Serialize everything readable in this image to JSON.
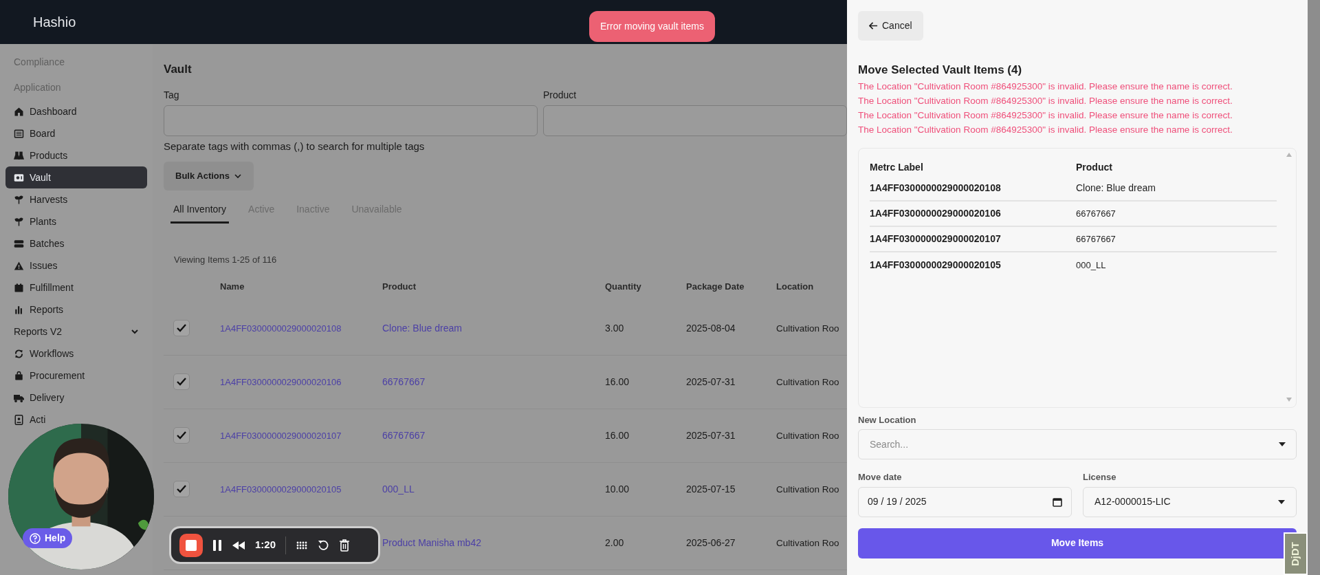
{
  "app": {
    "name": "Hashio"
  },
  "toast": {
    "text": "Error moving vault items"
  },
  "sidebar": {
    "sections": [
      "Compliance",
      "Application"
    ],
    "items": [
      {
        "label": "Dashboard",
        "selected": false
      },
      {
        "label": "Board",
        "selected": false
      },
      {
        "label": "Products",
        "selected": false
      },
      {
        "label": "Vault",
        "selected": true
      },
      {
        "label": "Harvests",
        "selected": false
      },
      {
        "label": "Plants",
        "selected": false
      },
      {
        "label": "Batches",
        "selected": false
      },
      {
        "label": "Issues",
        "selected": false
      },
      {
        "label": "Fulfillment",
        "selected": false
      },
      {
        "label": "Reports",
        "selected": false
      },
      {
        "label": "Reports V2",
        "selected": false,
        "kind": "group",
        "expanded": false
      },
      {
        "label": "Workflows",
        "selected": false
      },
      {
        "label": "Procurement",
        "selected": false
      },
      {
        "label": "Delivery",
        "selected": false
      },
      {
        "label": "Acti",
        "selected": false
      }
    ]
  },
  "main": {
    "title": "Vault",
    "filters": [
      {
        "label": "Tag"
      },
      {
        "label": "Product"
      }
    ],
    "hint": "Separate tags with commas (,) to search for multiple tags",
    "bulk_button": "Bulk Actions",
    "tabs": [
      {
        "label": "All Inventory",
        "selected": true
      },
      {
        "label": "Active",
        "selected": false
      },
      {
        "label": "Inactive",
        "selected": false
      },
      {
        "label": "Unavailable",
        "selected": false
      }
    ],
    "count": "Viewing Items 1-25 of 116",
    "table": {
      "columns": [
        "Name",
        "Product",
        "Quantity",
        "Package Date",
        "Location"
      ],
      "rows": [
        {
          "checked": true,
          "name": "1A4FF0300000029000020108",
          "product": "Clone: Blue dream",
          "quantity": "3.00",
          "date": "2025-08-04",
          "location": "Cultivation Roo"
        },
        {
          "checked": true,
          "name": "1A4FF0300000029000020106",
          "product": "66767667",
          "quantity": "16.00",
          "date": "2025-07-31",
          "location": "Cultivation Roo"
        },
        {
          "checked": true,
          "name": "1A4FF0300000029000020107",
          "product": "66767667",
          "quantity": "16.00",
          "date": "2025-07-31",
          "location": "Cultivation Roo"
        },
        {
          "checked": true,
          "name": "1A4FF0300000029000020105",
          "product": "000_LL",
          "quantity": "10.00",
          "date": "2025-07-15",
          "location": "Cultivation Roo"
        },
        {
          "product": "Product Manisha mb42",
          "quantity": "2.00",
          "date": "2025-06-27",
          "location": "Cultivation Roo"
        }
      ]
    }
  },
  "panel": {
    "cancel": "Cancel",
    "title": "Move Selected Vault Items (4)",
    "errors": [
      "The Location \"Cultivation Room #864925300\" is invalid. Please ensure the name is correct.",
      "The Location \"Cultivation Room #864925300\" is invalid. Please ensure the name is correct.",
      "The Location \"Cultivation Room #864925300\" is invalid. Please ensure the name is correct.",
      "The Location \"Cultivation Room #864925300\" is invalid. Please ensure the name is correct."
    ],
    "table": {
      "columns": [
        "Metrc Label",
        "Product"
      ],
      "rows": [
        [
          "1A4FF0300000029000020108",
          "Clone: Blue dream"
        ],
        [
          "1A4FF0300000029000020106",
          "66767667"
        ],
        [
          "1A4FF0300000029000020107",
          "66767667"
        ],
        [
          "1A4FF0300000029000020105",
          "000_LL"
        ]
      ]
    },
    "location": {
      "label": "New Location",
      "placeholder": "Search..."
    },
    "date": {
      "label": "Move date",
      "value": "09 / 19 / 2025"
    },
    "license": {
      "label": "License",
      "value": "A12-0000015-LIC"
    },
    "submit": "Move Items"
  },
  "help_button": "Help",
  "recorder": {
    "time": "1:20"
  },
  "debug_toolbar": "DjDT"
}
